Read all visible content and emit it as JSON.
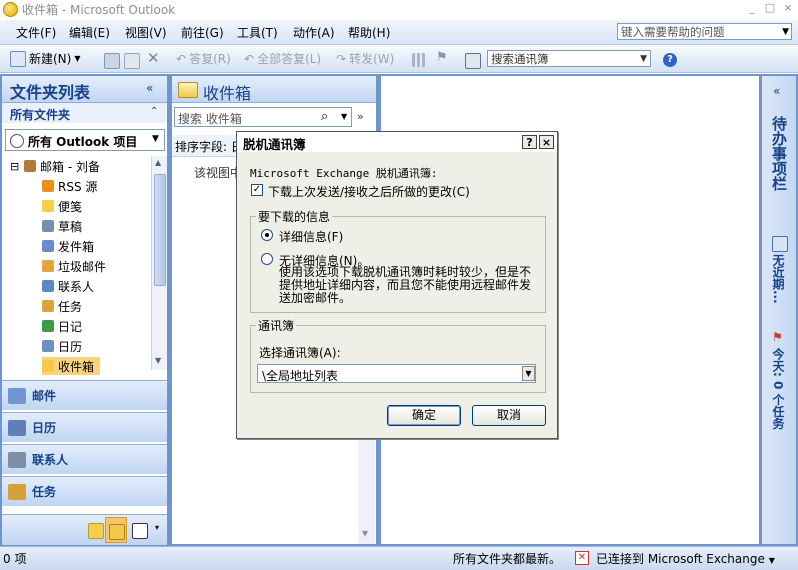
{
  "window": {
    "title": "收件箱 - Microsoft Outlook",
    "min": "_",
    "max": "□",
    "close": "×"
  },
  "menu": {
    "items": [
      "文件(F)",
      "编辑(E)",
      "视图(V)",
      "前往(G)",
      "工具(T)",
      "动作(A)",
      "帮助(H)"
    ],
    "help_placeholder": "键入需要帮助的问题"
  },
  "toolbar": {
    "new": "新建(N)",
    "reply": "答复(R)",
    "reply_all": "全部答复(L)",
    "forward": "转发(W)",
    "address_book": "搜索通讯簿"
  },
  "folder_pane": {
    "title": "文件夹列表",
    "collapse": "«",
    "all_folders": "所有文件夹",
    "all_folders_collapse": "⌃",
    "combo": "所有 Outlook 项目",
    "tree": [
      {
        "label": "邮箱 - 刘备",
        "icon": "mailbox-icon",
        "color": "#b07a3a"
      },
      {
        "label": "RSS 源",
        "icon": "rss-icon",
        "color": "#f08c1a"
      },
      {
        "label": "便笺",
        "icon": "notes-icon",
        "color": "#f4d04a"
      },
      {
        "label": "草稿",
        "icon": "drafts-icon",
        "color": "#7a8fb0"
      },
      {
        "label": "发件箱",
        "icon": "outbox-icon",
        "color": "#6a8ccf"
      },
      {
        "label": "垃圾邮件",
        "icon": "junk-icon",
        "color": "#e2a63a"
      },
      {
        "label": "联系人",
        "icon": "contacts-icon",
        "color": "#5d87c7"
      },
      {
        "label": "任务",
        "icon": "tasks-icon",
        "color": "#d9a23a"
      },
      {
        "label": "日记",
        "icon": "journal-icon",
        "color": "#3f9b4c"
      },
      {
        "label": "日历",
        "icon": "calendar-icon",
        "color": "#6c8fc4"
      },
      {
        "label": "收件箱",
        "icon": "inbox-icon",
        "color": "#f1c94b"
      }
    ],
    "nav": [
      {
        "label": "邮件",
        "icon": "mail-icon",
        "color": "#6f96cf"
      },
      {
        "label": "日历",
        "icon": "calendar-icon",
        "color": "#5e7fb8"
      },
      {
        "label": "联系人",
        "icon": "contacts-icon",
        "color": "#7b8fa6"
      },
      {
        "label": "任务",
        "icon": "tasks-icon",
        "color": "#d3a13a"
      }
    ]
  },
  "list_pane": {
    "title": "收件箱",
    "search_placeholder": "搜索 收件箱",
    "sort_label": "排序字段: 日",
    "empty_text": "该视图中",
    "expand": "»"
  },
  "todo_bar": {
    "title": "待办事项栏",
    "no_appointments": "无近期...",
    "tasks_today": "今天: 0 个任务",
    "collapse": "«"
  },
  "status": {
    "items": "0 项",
    "sync": "所有文件夹都最新。",
    "connection": "已连接到 Microsoft Exchange"
  },
  "dialog": {
    "title": "脱机通讯簿",
    "help": "?",
    "close": "×",
    "intro": "Microsoft Exchange 脱机通讯簿:",
    "download_changes": "下载上次发送/接收之后所做的更改(C)",
    "info_group": "要下载的信息",
    "full_details": "详细信息(F)",
    "no_details": "无详细信息(N)。",
    "no_details_desc": "使用该选项下载脱机通讯簿时耗时较少，但是不提供地址详细内容，而且您不能使用远程邮件发送加密邮件。",
    "ab_group": "通讯簿",
    "choose_ab": "选择通讯簿(A):",
    "ab_value": "\\全局地址列表",
    "ok": "确定",
    "cancel": "取消"
  }
}
